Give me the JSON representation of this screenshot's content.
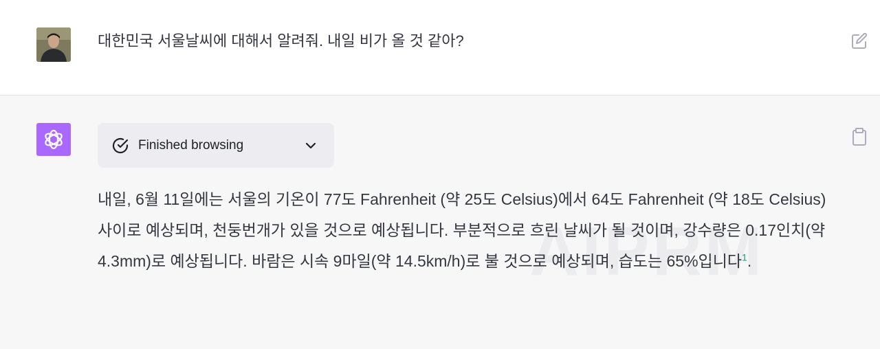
{
  "user_message": {
    "text": "대한민국 서울날씨에 대해서 알려줘. 내일 비가 올 것 같아?",
    "avatar_icon": "user-photo",
    "edit_icon": "edit-icon"
  },
  "assistant_message": {
    "avatar_icon": "openai-logo",
    "avatar_color": "#ab68ff",
    "browsing": {
      "label": "Finished browsing",
      "status_icon": "check-circle-icon",
      "expand_icon": "chevron-down-icon"
    },
    "answer_text": "내일, 6월 11일에는 서울의 기온이 77도 Fahrenheit (약 25도 Celsius)에서 64도 Fahrenheit (약 18도 Celsius) 사이로 예상되며, 천둥번개가 있을 것으로 예상됩니다. 부분적으로 흐린 날씨가 될 것이며, 강수량은 0.17인치(약 4.3mm)로 예상됩니다. 바람은 시속 9마일(약 14.5km/h)로 불 것으로 예상되며, 습도는 65%입니다",
    "citation": "1",
    "answer_end": ".",
    "copy_icon": "clipboard-icon",
    "accent_color": "#10a37f"
  },
  "watermark": "AIPRM"
}
